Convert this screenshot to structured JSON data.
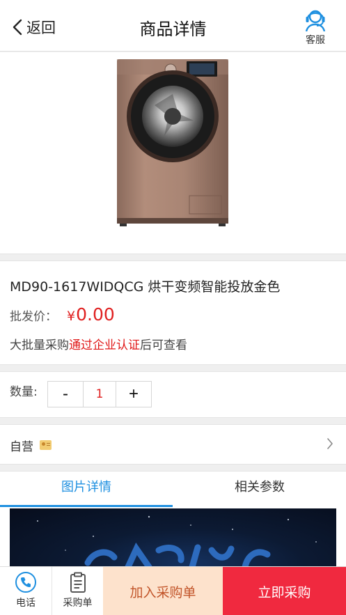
{
  "header": {
    "back_label": "返回",
    "title": "商品详情",
    "service_label": "客服"
  },
  "product": {
    "name": "MD90-1617WIDQCG 烘干变频智能投放金色",
    "price_label": "批发价：",
    "price_currency": "¥",
    "price_value": "0.00",
    "notice_prefix": "大批量采购",
    "notice_link": "通过企业认证",
    "notice_suffix": "后可查看"
  },
  "quantity": {
    "label": "数量:",
    "minus": "-",
    "value": "1",
    "plus": "+"
  },
  "seller": {
    "label": "自营"
  },
  "tabs": [
    {
      "label": "图片详情",
      "active": true
    },
    {
      "label": "相关参数",
      "active": false
    }
  ],
  "bottom_bar": {
    "phone_label": "电话",
    "orders_label": "采购单",
    "add_to_cart": "加入采购单",
    "buy_now": "立即采购"
  },
  "colors": {
    "accent_blue": "#1d8fe0",
    "price_red": "#e02020",
    "buy_red": "#f0293f",
    "cart_bg": "#fde2cc",
    "cart_text": "#c2552a"
  }
}
